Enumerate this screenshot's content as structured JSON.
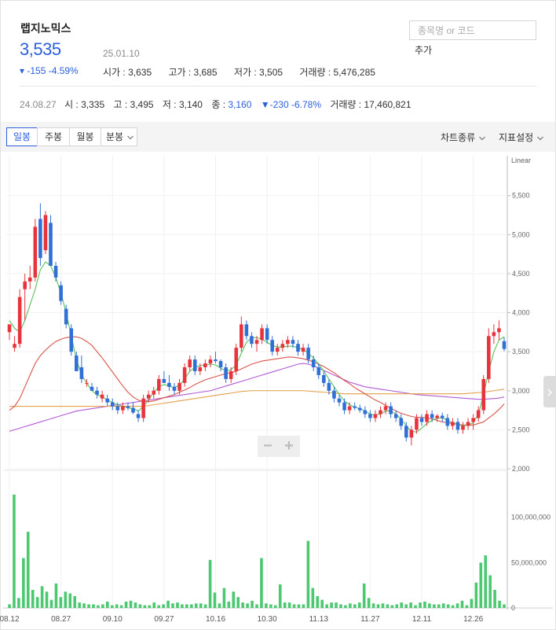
{
  "stock": {
    "name": "랩지노믹스",
    "price": "3,535",
    "date": "25.01.10",
    "change": "▾ -155 -4.59%",
    "open": "시가 : 3,635",
    "high": "고가 : 3,685",
    "low": "저가 : 3,505",
    "volume": "거래량 : 5,476,285"
  },
  "search": {
    "placeholder": "종목명 or 코드",
    "add_label": "추가"
  },
  "compare": {
    "date": "24.08.27",
    "open": "시 : 3,335",
    "high": "고 : 3,495",
    "low": "저 : 3,140",
    "close_label": "종 : ",
    "close_value": "3,160",
    "change": "▼-230 -6.78%",
    "volume": "거래량 : 17,460,821"
  },
  "toolbar": {
    "tabs": [
      "일봉",
      "주봉",
      "월봉",
      "분봉"
    ],
    "active_tab": "일봉",
    "chart_type": "차트종류",
    "indicator": "지표설정"
  },
  "zoom": {
    "minus": "−",
    "plus": "+"
  },
  "colors": {
    "up": "#e8323c",
    "down": "#2f6fd6",
    "volume": "#4cc870",
    "ma5": "#56c25a",
    "ma20": "#d9544a",
    "ma60": "#e3a048",
    "ma120": "#b25ad6"
  },
  "chart_data": {
    "type": "candlestick",
    "scale_label": "Linear",
    "price_ticks": [
      2000,
      2500,
      3000,
      3500,
      4000,
      4500,
      5000,
      5500
    ],
    "price_tick_labels": [
      "2,000",
      "2,500",
      "3,000",
      "3,500",
      "4,000",
      "4,500",
      "5,000",
      "5,500"
    ],
    "volume_ticks": [
      0,
      50000000,
      100000000
    ],
    "volume_tick_labels": [
      "0",
      "50,000,000",
      "100,000,000"
    ],
    "x_labels": [
      "08.12",
      "08.27",
      "09.10",
      "09.27",
      "10.16",
      "10.30",
      "11.13",
      "11.27",
      "12.11",
      "12.26"
    ],
    "x_label_index": [
      0,
      10,
      20,
      30,
      40,
      50,
      60,
      70,
      80,
      90
    ],
    "candles": [
      [
        3750,
        3850,
        3650,
        3850
      ],
      [
        3550,
        3700,
        3500,
        3600
      ],
      [
        3600,
        4300,
        3550,
        4200
      ],
      [
        4300,
        4500,
        3900,
        4400
      ],
      [
        4400,
        4600,
        4300,
        4450
      ],
      [
        4450,
        5200,
        4400,
        5100
      ],
      [
        5200,
        5400,
        4600,
        4700
      ],
      [
        4800,
        5300,
        4750,
        5250
      ],
      [
        5150,
        5250,
        4600,
        4600
      ],
      [
        4600,
        4650,
        4400,
        4450
      ],
      [
        4350,
        4400,
        4100,
        4150
      ],
      [
        4050,
        4100,
        3800,
        3850
      ],
      [
        3800,
        3850,
        3450,
        3500
      ],
      [
        3450,
        3500,
        3250,
        3250
      ],
      [
        3300,
        3450,
        3100,
        3150
      ],
      [
        3100,
        3150,
        3050,
        3100
      ],
      [
        3050,
        3100,
        3000,
        3000
      ],
      [
        3000,
        3050,
        2900,
        2950
      ],
      [
        2900,
        3000,
        2850,
        2950
      ],
      [
        2900,
        2950,
        2800,
        2850
      ],
      [
        2850,
        2900,
        2750,
        2800
      ],
      [
        2800,
        2850,
        2700,
        2750
      ],
      [
        2750,
        2850,
        2700,
        2800
      ],
      [
        2800,
        2850,
        2750,
        2780
      ],
      [
        2780,
        2850,
        2700,
        2720
      ],
      [
        2700,
        2750,
        2600,
        2650
      ],
      [
        2650,
        2950,
        2600,
        2900
      ],
      [
        2900,
        3000,
        2850,
        2950
      ],
      [
        2950,
        3050,
        2900,
        3000
      ],
      [
        3000,
        3200,
        2950,
        3150
      ],
      [
        3150,
        3250,
        3100,
        3100
      ],
      [
        3100,
        3200,
        3000,
        3050
      ],
      [
        3050,
        3100,
        2950,
        3000
      ],
      [
        3000,
        3150,
        2950,
        3100
      ],
      [
        3100,
        3350,
        3050,
        3300
      ],
      [
        3300,
        3450,
        3250,
        3400
      ],
      [
        3400,
        3450,
        3200,
        3250
      ],
      [
        3250,
        3350,
        3200,
        3300
      ],
      [
        3300,
        3400,
        3250,
        3350
      ],
      [
        3350,
        3450,
        3300,
        3400
      ],
      [
        3400,
        3500,
        3350,
        3380
      ],
      [
        3380,
        3400,
        3250,
        3300
      ],
      [
        3300,
        3350,
        3100,
        3150
      ],
      [
        3150,
        3300,
        3100,
        3250
      ],
      [
        3250,
        3600,
        3200,
        3550
      ],
      [
        3550,
        3950,
        3500,
        3850
      ],
      [
        3850,
        3900,
        3650,
        3700
      ],
      [
        3700,
        3750,
        3550,
        3600
      ],
      [
        3600,
        3700,
        3500,
        3650
      ],
      [
        3650,
        3850,
        3600,
        3800
      ],
      [
        3800,
        3850,
        3600,
        3650
      ],
      [
        3650,
        3700,
        3450,
        3500
      ],
      [
        3500,
        3600,
        3450,
        3550
      ],
      [
        3550,
        3650,
        3500,
        3600
      ],
      [
        3600,
        3700,
        3550,
        3650
      ],
      [
        3650,
        3700,
        3550,
        3600
      ],
      [
        3600,
        3650,
        3450,
        3500
      ],
      [
        3500,
        3600,
        3450,
        3550
      ],
      [
        3550,
        3600,
        3350,
        3400
      ],
      [
        3400,
        3450,
        3250,
        3300
      ],
      [
        3300,
        3350,
        3150,
        3200
      ],
      [
        3200,
        3250,
        3050,
        3100
      ],
      [
        3100,
        3150,
        2950,
        3000
      ],
      [
        3000,
        3050,
        2850,
        2900
      ],
      [
        2900,
        2950,
        2800,
        2850
      ],
      [
        2850,
        2900,
        2700,
        2750
      ],
      [
        2750,
        2850,
        2700,
        2800
      ],
      [
        2800,
        2850,
        2750,
        2780
      ],
      [
        2780,
        2820,
        2720,
        2750
      ],
      [
        2750,
        2800,
        2650,
        2700
      ],
      [
        2700,
        2750,
        2600,
        2650
      ],
      [
        2650,
        2750,
        2600,
        2700
      ],
      [
        2700,
        2800,
        2650,
        2750
      ],
      [
        2750,
        2850,
        2700,
        2800
      ],
      [
        2800,
        2850,
        2650,
        2700
      ],
      [
        2700,
        2750,
        2600,
        2650
      ],
      [
        2650,
        2700,
        2500,
        2550
      ],
      [
        2550,
        2600,
        2350,
        2400
      ],
      [
        2400,
        2550,
        2300,
        2500
      ],
      [
        2500,
        2700,
        2450,
        2650
      ],
      [
        2650,
        2700,
        2550,
        2600
      ],
      [
        2600,
        2750,
        2550,
        2700
      ],
      [
        2700,
        2750,
        2600,
        2650
      ],
      [
        2650,
        2700,
        2600,
        2680
      ],
      [
        2680,
        2720,
        2600,
        2650
      ],
      [
        2650,
        2700,
        2500,
        2550
      ],
      [
        2550,
        2650,
        2500,
        2600
      ],
      [
        2600,
        2650,
        2450,
        2500
      ],
      [
        2500,
        2600,
        2450,
        2550
      ],
      [
        2550,
        2650,
        2500,
        2600
      ],
      [
        2600,
        2700,
        2500,
        2650
      ],
      [
        2650,
        2800,
        2600,
        2750
      ],
      [
        2750,
        3200,
        2700,
        3150
      ],
      [
        3150,
        3800,
        3100,
        3700
      ],
      [
        3700,
        3850,
        3600,
        3750
      ],
      [
        3750,
        3900,
        3650,
        3800
      ],
      [
        3635,
        3685,
        3505,
        3535
      ]
    ],
    "volumes": [
      4,
      125,
      11,
      55,
      84,
      20,
      12,
      24,
      18,
      9,
      27,
      12,
      18,
      16,
      13,
      6,
      5,
      4,
      4,
      3,
      4,
      7,
      3,
      4,
      3,
      7,
      8,
      6,
      4,
      3,
      3,
      6,
      3,
      4,
      8,
      5,
      6,
      4,
      4,
      4,
      5,
      5,
      4,
      53,
      17,
      5,
      22,
      7,
      18,
      12,
      6,
      5,
      8,
      4,
      55,
      5,
      4,
      3,
      26,
      6,
      6,
      4,
      4,
      4,
      74,
      22,
      13,
      9,
      4,
      6,
      6,
      4,
      3,
      5,
      4,
      6,
      27,
      11,
      5,
      4,
      5,
      4,
      3,
      4,
      6,
      4,
      6,
      3,
      6,
      7,
      5,
      4,
      4,
      5,
      4,
      3,
      5,
      8,
      3,
      10,
      28,
      50,
      58,
      36,
      20,
      8,
      4
    ],
    "ma5": [
      3900,
      3800,
      3750,
      3900,
      4100,
      4300,
      4550,
      4650,
      4600,
      4450,
      4250,
      4000,
      3700,
      3400,
      3200,
      3100,
      3000,
      2950,
      2920,
      2880,
      2850,
      2820,
      2800,
      2780,
      2770,
      2740,
      2800,
      2880,
      2980,
      3050,
      3080,
      3060,
      3040,
      3070,
      3150,
      3250,
      3300,
      3320,
      3330,
      3340,
      3330,
      3290,
      3250,
      3270,
      3330,
      3480,
      3620,
      3680,
      3680,
      3660,
      3620,
      3580,
      3560,
      3560,
      3570,
      3570,
      3550,
      3530,
      3480,
      3420,
      3340,
      3250,
      3150,
      3050,
      2950,
      2870,
      2820,
      2790,
      2770,
      2740,
      2700,
      2690,
      2700,
      2740,
      2740,
      2700,
      2640,
      2550,
      2480,
      2470,
      2520,
      2580,
      2620,
      2650,
      2650,
      2620,
      2590,
      2570,
      2550,
      2560,
      2590,
      2700,
      2950,
      3250,
      3500,
      3650,
      3690
    ],
    "ma20": [
      2750,
      2800,
      2900,
      3050,
      3200,
      3350,
      3450,
      3520,
      3580,
      3630,
      3660,
      3680,
      3690,
      3690,
      3670,
      3630,
      3580,
      3500,
      3420,
      3330,
      3240,
      3150,
      3060,
      2980,
      2920,
      2880,
      2860,
      2860,
      2870,
      2890,
      2910,
      2930,
      2950,
      2980,
      3010,
      3040,
      3080,
      3110,
      3140,
      3160,
      3180,
      3200,
      3220,
      3230,
      3250,
      3280,
      3310,
      3340,
      3360,
      3380,
      3390,
      3400,
      3410,
      3420,
      3430,
      3430,
      3420,
      3410,
      3390,
      3370,
      3340,
      3310,
      3270,
      3230,
      3180,
      3130,
      3090,
      3040,
      3000,
      2960,
      2920,
      2880,
      2850,
      2810,
      2780,
      2740,
      2710,
      2690,
      2670,
      2660,
      2660,
      2650,
      2640,
      2620,
      2600,
      2590,
      2580,
      2570,
      2560,
      2560,
      2560,
      2580,
      2600,
      2650,
      2700,
      2760,
      2830
    ],
    "ma60": [
      2800,
      2800,
      2800,
      2800,
      2800,
      2800,
      2800,
      2800,
      2800,
      2800,
      2800,
      2800,
      2800,
      2800,
      2800,
      2800,
      2800,
      2800,
      2800,
      2800,
      2800,
      2800,
      2800,
      2800,
      2800,
      2800,
      2800,
      2810,
      2820,
      2830,
      2840,
      2850,
      2860,
      2870,
      2880,
      2890,
      2900,
      2910,
      2920,
      2930,
      2940,
      2950,
      2960,
      2970,
      2980,
      2990,
      2995,
      3000,
      3000,
      3000,
      3000,
      3000,
      3000,
      3000,
      3000,
      3000,
      3000,
      3000,
      2995,
      2990,
      2985,
      2980,
      2975,
      2970,
      2965,
      2960,
      2960,
      2960,
      2960,
      2960,
      2960,
      2960,
      2960,
      2960,
      2960,
      2960,
      2960,
      2960,
      2960,
      2960,
      2960,
      2960,
      2960,
      2960,
      2960,
      2960,
      2960,
      2960,
      2960,
      2965,
      2970,
      2975,
      2980,
      2990,
      3000,
      3010,
      3020
    ],
    "ma120": [
      2480,
      2500,
      2520,
      2540,
      2560,
      2580,
      2600,
      2620,
      2640,
      2660,
      2680,
      2700,
      2720,
      2740,
      2750,
      2760,
      2770,
      2780,
      2790,
      2800,
      2810,
      2820,
      2830,
      2840,
      2850,
      2860,
      2870,
      2880,
      2890,
      2900,
      2910,
      2920,
      2930,
      2940,
      2950,
      2960,
      2970,
      2980,
      2990,
      3000,
      3020,
      3040,
      3060,
      3080,
      3100,
      3120,
      3140,
      3160,
      3180,
      3200,
      3220,
      3240,
      3260,
      3280,
      3300,
      3320,
      3340,
      3350,
      3340,
      3320,
      3290,
      3260,
      3230,
      3200,
      3170,
      3140,
      3110,
      3090,
      3070,
      3050,
      3040,
      3030,
      3020,
      3010,
      3000,
      2990,
      2980,
      2970,
      2960,
      2950,
      2945,
      2940,
      2935,
      2930,
      2925,
      2920,
      2915,
      2910,
      2905,
      2900,
      2895,
      2890,
      2890,
      2895,
      2900,
      2905,
      2920
    ]
  }
}
